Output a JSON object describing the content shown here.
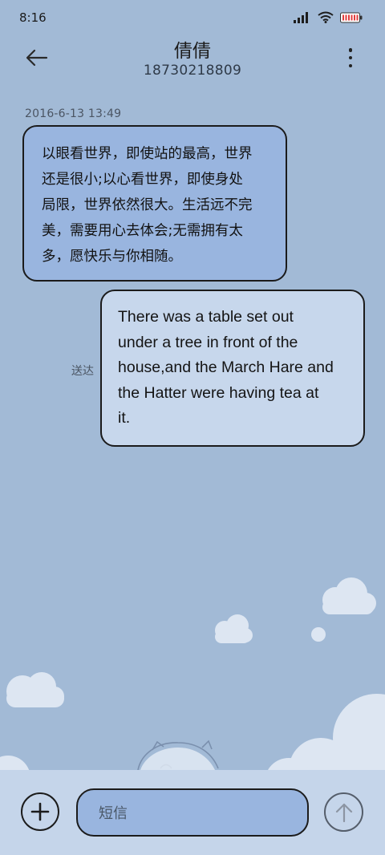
{
  "status_bar": {
    "time": "8:16",
    "icons": [
      "signal-icon",
      "wifi-icon",
      "battery-icon"
    ]
  },
  "header": {
    "contact_name": "倩倩",
    "contact_number": "18730218809",
    "back_icon": "back-arrow-icon",
    "more_icon": "more-vertical-icon"
  },
  "messages": [
    {
      "direction": "incoming",
      "timestamp": "2016-6-13 13:49",
      "lines": [
        "以眼看世界，即使站的最高，世界",
        "还是很小;以心看世界，即使身处",
        "局限，世界依然很大。生活远不完",
        "美，需要用心去体会;无需拥有太",
        "多，愿快乐与你相随。"
      ]
    },
    {
      "direction": "outgoing",
      "status": "送达",
      "lines": [
        "There was a table set out",
        "under a tree in front of the",
        "house,and the March Hare and",
        "the Hatter were having tea at",
        "it."
      ]
    }
  ],
  "composer": {
    "attach_icon": "plus-icon",
    "placeholder": "短信",
    "send_icon": "send-arrow-up-icon"
  },
  "colors": {
    "background": "#a2bad6",
    "incoming_bubble": "#99b5df",
    "outgoing_bubble": "#c7d7ec",
    "composer_bar": "#c5d5ea"
  }
}
